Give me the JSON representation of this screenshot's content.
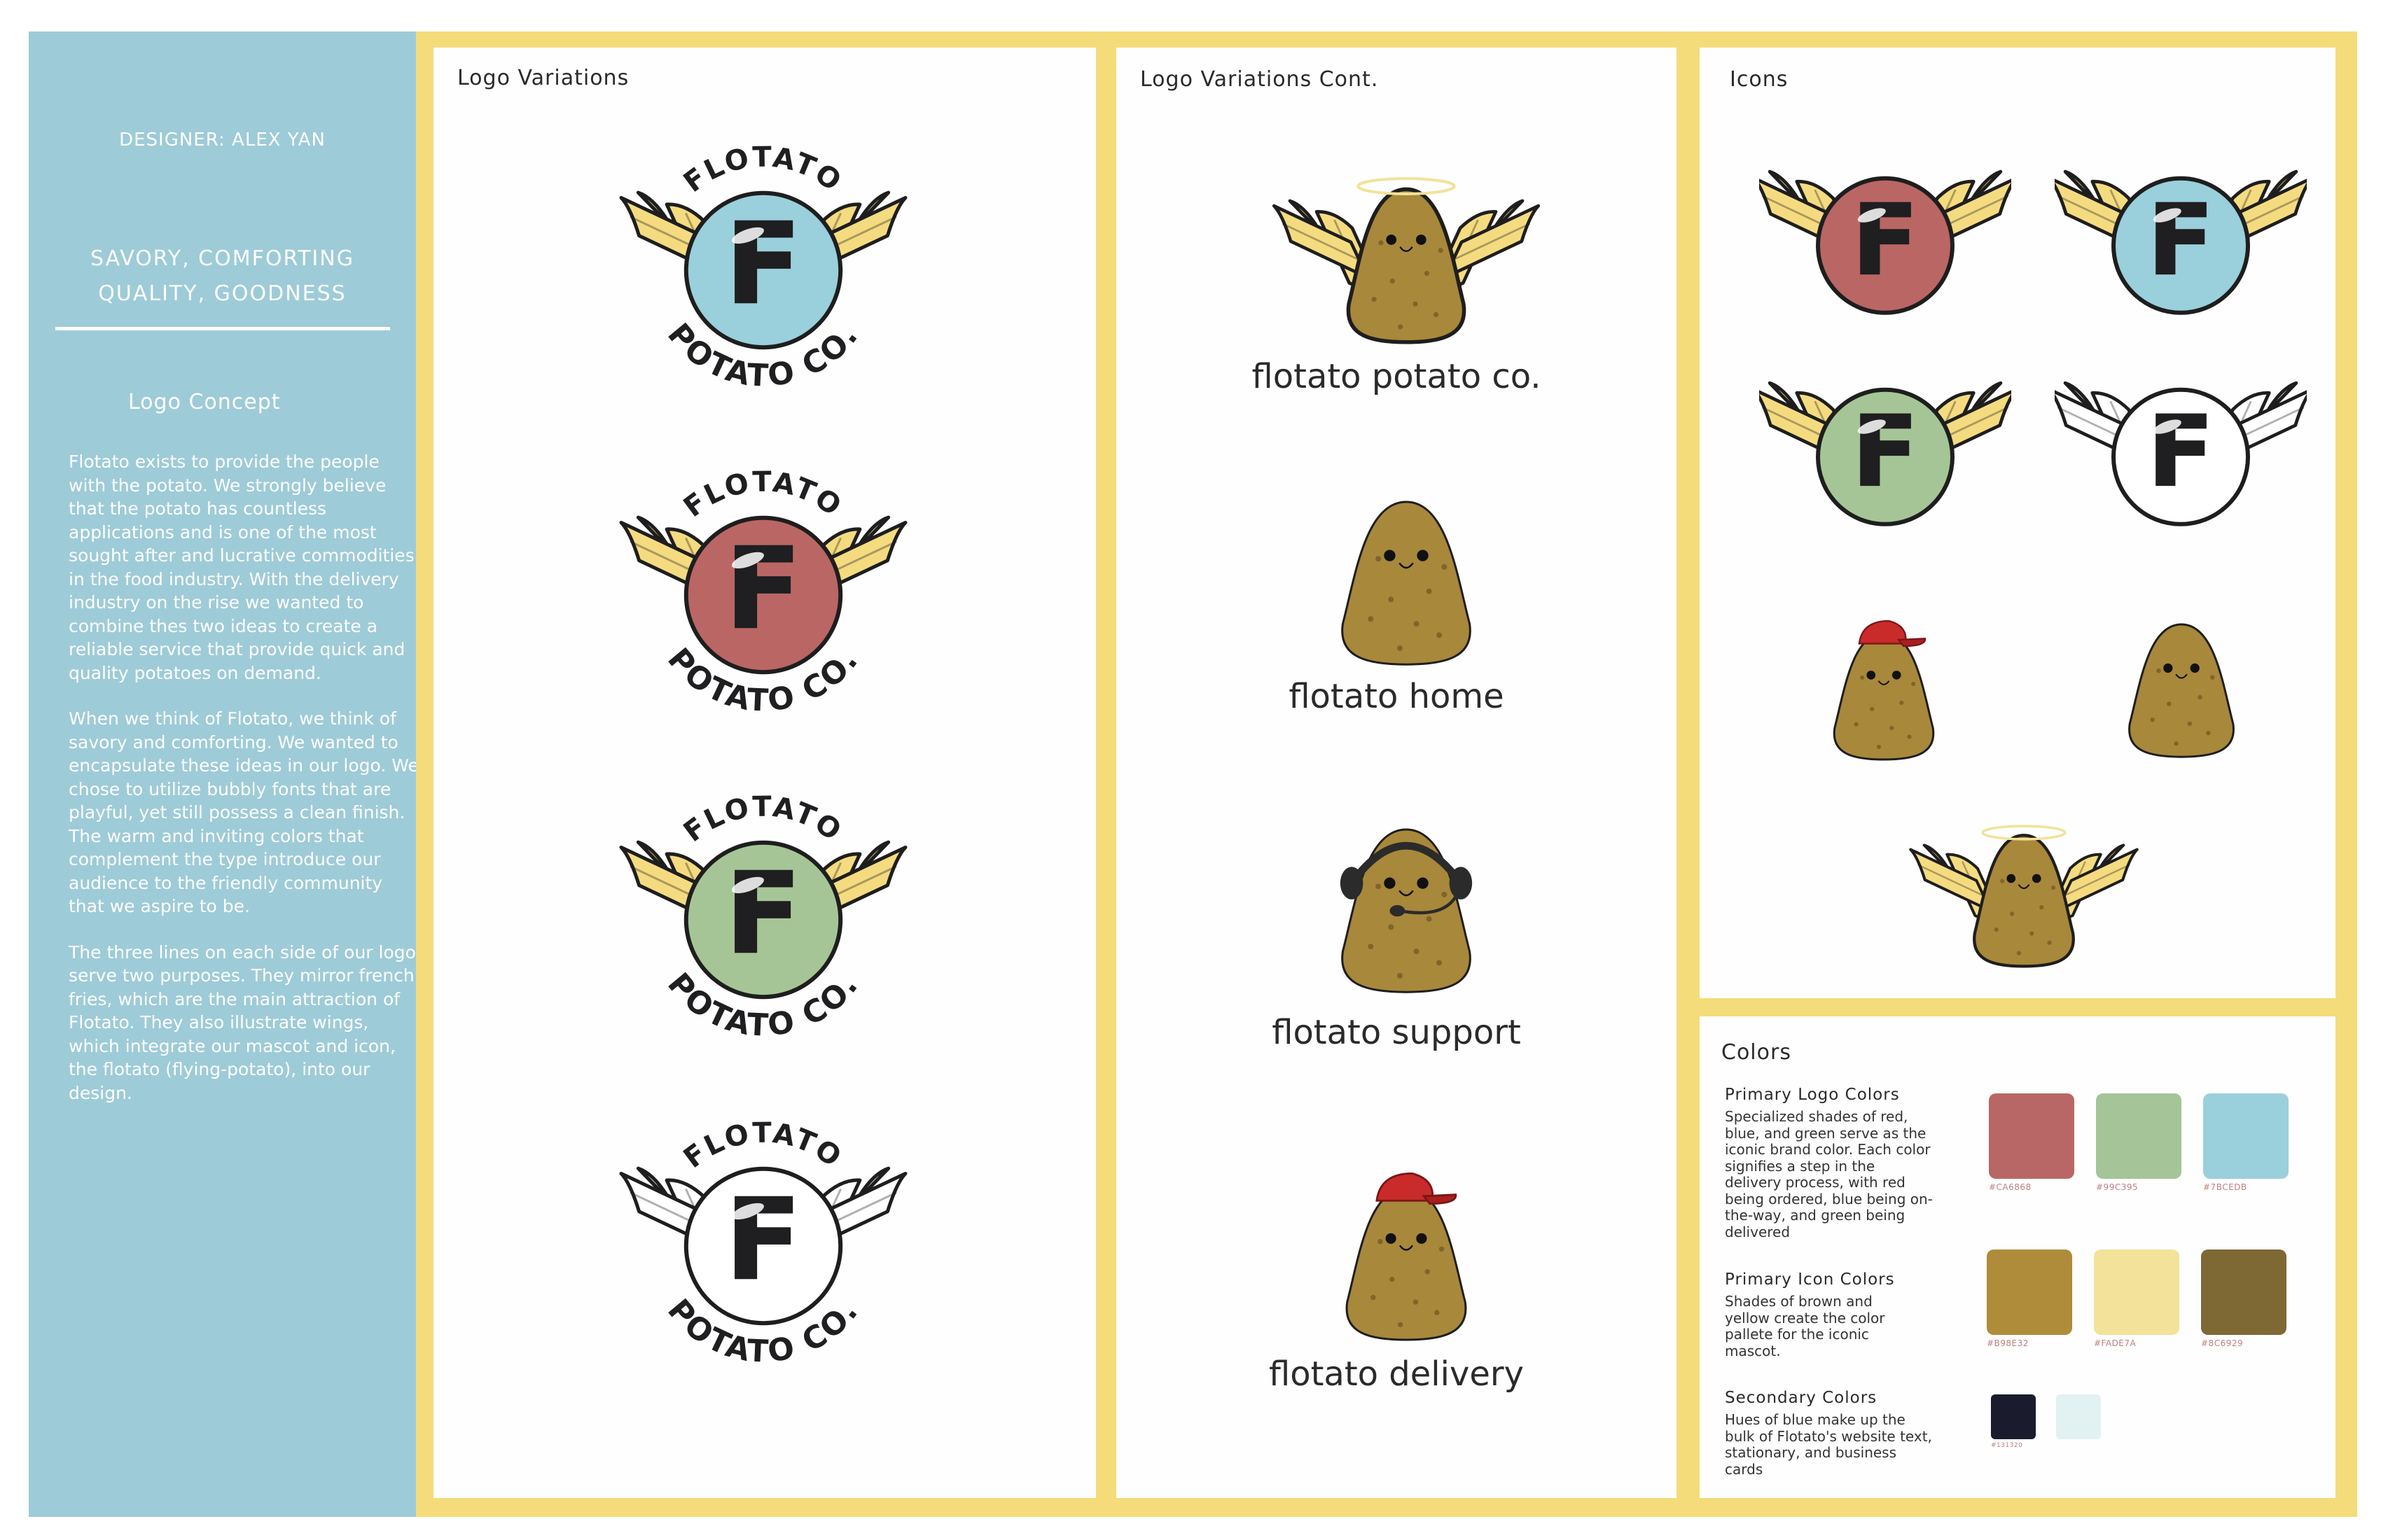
{
  "sidebar": {
    "designer": "DESIGNER: ALEX YAN",
    "tagline_line1": "SAVORY, COMFORTING",
    "tagline_line2": "QUALITY, GOODNESS",
    "concept_title": "Logo Concept",
    "paragraphs": [
      "Flotato exists to provide the people with the potato. We strongly believe that the potato has countless applications and is one of the most sought after and lucrative commodities in the food industry. With the delivery industry on the rise we wanted to combine thes two ideas to create a  reliable service that provide quick and quality potatoes on demand.",
      "When we think of Flotato, we think of savory and comforting. We wanted to encapsulate these ideas in our logo. We chose to utilize bubbly fonts that are playful, yet still possess a clean finish. The warm and inviting colors that complement the type introduce our audience to the friendly community that we aspire to be.",
      "The three lines on each side of our logo serve two purposes. They mirror french fries, which are the main attraction of Flotato. They also illustrate wings, which integrate our mascot and icon, the  flotato (flying-potato), into our design."
    ]
  },
  "panels": {
    "logo_variations": "Logo Variations",
    "logo_variations_cont": "Logo Variations Cont.",
    "icons": "Icons",
    "colors": "Colors"
  },
  "logo": {
    "top_text": "FLOTATO",
    "bottom_text": "POTATO CO.",
    "letter": "F"
  },
  "logo_variants": [
    {
      "name": "blue",
      "circle_color": "#9ACFDC",
      "wing_color": "#F5DB80"
    },
    {
      "name": "red",
      "circle_color": "#BA6665",
      "wing_color": "#F5DB80"
    },
    {
      "name": "green",
      "circle_color": "#A6C597",
      "wing_color": "#F5DB80"
    },
    {
      "name": "white",
      "circle_color": "#FFFFFF",
      "wing_color": "#FFFFFF"
    }
  ],
  "mascots": [
    {
      "variant": "halo-wings",
      "caption": "flotato potato co."
    },
    {
      "variant": "plain",
      "caption": "flotato home"
    },
    {
      "variant": "headset",
      "caption": "flotato support"
    },
    {
      "variant": "cap",
      "caption": "flotato delivery"
    }
  ],
  "colors": {
    "primary_logo": {
      "title": "Primary Logo Colors",
      "description": "Specialized shades of red, blue, and green serve as the iconic brand color. Each color signifies a step in the delivery process, with red being ordered, blue being on-the-way, and green being delivered",
      "swatches": [
        {
          "hex_label": "#CA6868",
          "color": "#B96766"
        },
        {
          "hex_label": "#99C395",
          "color": "#A5C497"
        },
        {
          "hex_label": "#7BCEDB",
          "color": "#9ACFDC"
        }
      ]
    },
    "primary_icon": {
      "title": "Primary Icon Colors",
      "description": "Shades of brown and yellow create the color pallete for the iconic mascot.",
      "swatches": [
        {
          "hex_label": "#B98E32",
          "color": "#AF8C3A"
        },
        {
          "hex_label": "#FADE7A",
          "color": "#F2E29A"
        },
        {
          "hex_label": "#8C6929",
          "color": "#7E6834"
        }
      ]
    },
    "secondary": {
      "title": "Secondary Colors",
      "description": "Hues of blue make up the bulk of Flotato's website text, stationary, and business cards",
      "swatches": [
        {
          "hex_label": "#131320",
          "color": "#1A1C2E"
        },
        {
          "hex_label": "",
          "color": "#E2F1F1"
        }
      ]
    }
  },
  "palette": {
    "sidebar": "#9ECBD8",
    "frame": "#F5DC7A",
    "outline": "#1E1E1E",
    "potato": "#A8883A",
    "potato_spot": "#7F652A",
    "cap": "#C92B2B"
  }
}
